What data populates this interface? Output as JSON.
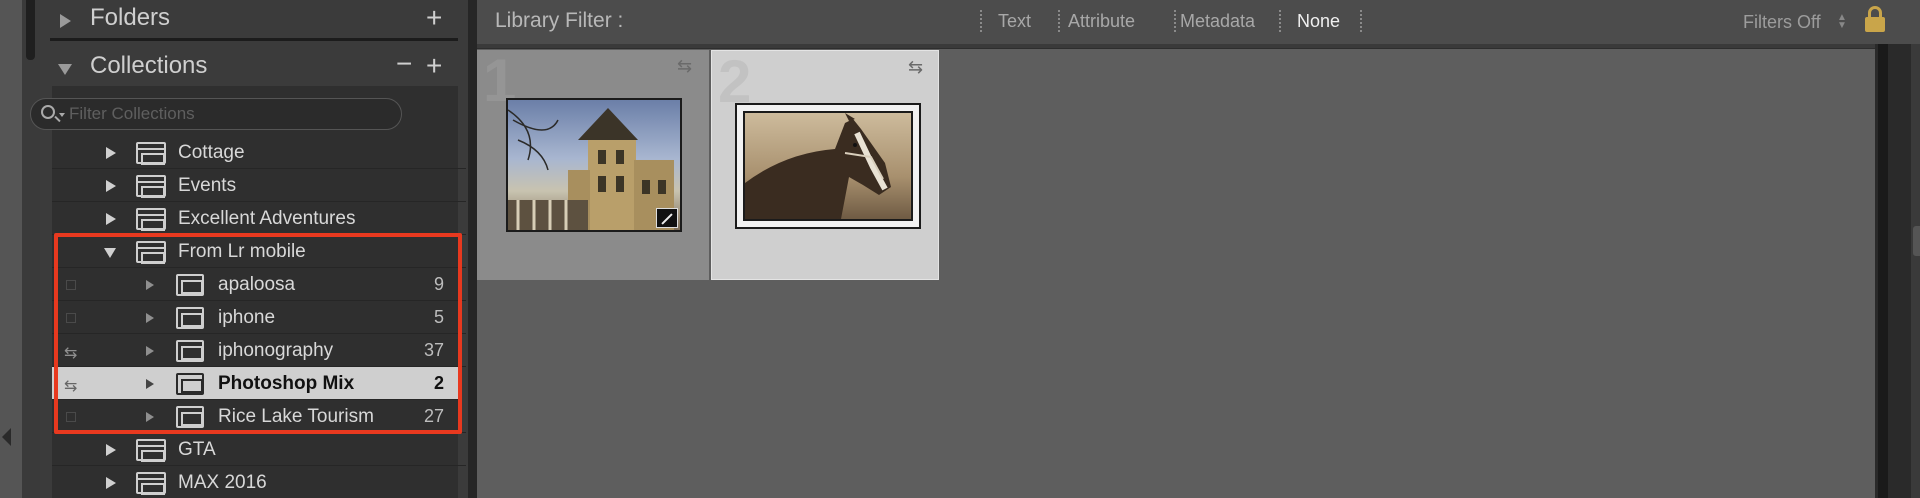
{
  "folders_panel": {
    "title": "Folders",
    "add_button": "+"
  },
  "collections_panel": {
    "title": "Collections",
    "remove_button": "−",
    "add_button": "+",
    "filter_placeholder": "Filter Collections",
    "items": [
      {
        "label": "Cottage",
        "type": "set",
        "expanded": false
      },
      {
        "label": "Events",
        "type": "set",
        "expanded": false
      },
      {
        "label": "Excellent Adventures",
        "type": "set",
        "expanded": false
      },
      {
        "label": "From Lr mobile",
        "type": "set",
        "expanded": true
      },
      {
        "label": "apaloosa",
        "type": "collection",
        "count": "9"
      },
      {
        "label": "iphone",
        "type": "collection",
        "count": "5"
      },
      {
        "label": "iphonography",
        "type": "collection",
        "count": "37",
        "synced": true
      },
      {
        "label": "Photoshop Mix",
        "type": "collection",
        "count": "2",
        "synced": true,
        "selected": true
      },
      {
        "label": "Rice Lake Tourism",
        "type": "collection",
        "count": "27"
      },
      {
        "label": "GTA",
        "type": "set",
        "expanded": false
      },
      {
        "label": "MAX 2016",
        "type": "set",
        "expanded": false
      }
    ]
  },
  "filter_bar": {
    "title": "Library Filter :",
    "options": [
      "Text",
      "Attribute",
      "Metadata",
      "None"
    ],
    "active_option": "None",
    "preset_label": "Filters Off",
    "lock_icon": "lock-icon"
  },
  "grid": {
    "cells": [
      {
        "index": "1",
        "image": "building-photo",
        "edited": true
      },
      {
        "index": "2",
        "image": "horse-photo",
        "selected": true
      }
    ]
  },
  "colors": {
    "highlight_box": "#e8391f",
    "selected_row": "#cfcfcf",
    "lock": "#c9a54a"
  }
}
